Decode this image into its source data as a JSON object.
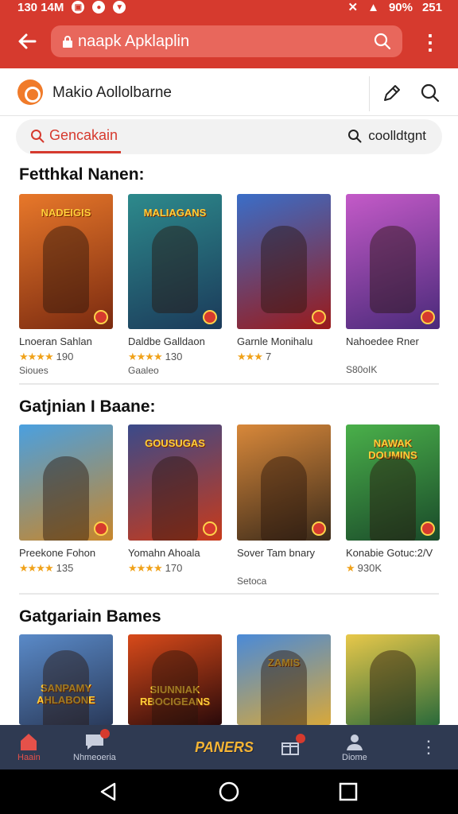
{
  "status_bar": {
    "time": "130 14M",
    "battery": "90%",
    "signal": "251"
  },
  "browser": {
    "url": "naapk Apklaplin"
  },
  "site": {
    "title": "Makio Aollolbarne"
  },
  "tabs": {
    "active_label": "Gencakain",
    "right_label": "coolldtgnt"
  },
  "sections": [
    {
      "title": "Fetthkal Nanen:",
      "items": [
        {
          "name": "Lnoeran Sahlan",
          "stars": "★★★★",
          "rating": "190",
          "sub": "Sioues",
          "logo": "NADEIGIS",
          "colors": [
            "#e8782a",
            "#7a2a10"
          ]
        },
        {
          "name": "Daldbe Galldaon",
          "stars": "★★★★",
          "rating": "130",
          "sub": "Gaaleo",
          "logo": "MALIAGANS",
          "colors": [
            "#2d8a8c",
            "#1b3a5a"
          ]
        },
        {
          "name": "Garnle Monihalu",
          "stars": "★★★",
          "rating": "7",
          "sub": "",
          "logo": "",
          "colors": [
            "#3a6ec8",
            "#9a1a1a"
          ]
        },
        {
          "name": "Nahoedee Rner",
          "stars": "",
          "rating": "",
          "sub": "S80oIK",
          "logo": "",
          "colors": [
            "#c45ac8",
            "#4a2a7a"
          ]
        }
      ]
    },
    {
      "title": "Gatjnian I Baane:",
      "items": [
        {
          "name": "Preekone Fohon",
          "stars": "★★★★",
          "rating": "135",
          "sub": "",
          "logo": "",
          "colors": [
            "#4aa0e0",
            "#c8862a"
          ]
        },
        {
          "name": "Yomahn Ahoala",
          "stars": "★★★★",
          "rating": "170",
          "sub": "",
          "logo": "GOUSUGAS",
          "colors": [
            "#3a4a8a",
            "#c83a1a"
          ]
        },
        {
          "name": "Sover Tam bnary",
          "stars": "",
          "rating": "",
          "sub": "Setoca",
          "logo": "",
          "colors": [
            "#d8883a",
            "#3a2a1a"
          ]
        },
        {
          "name": "Konabie Gotuc:2/V",
          "stars": "★",
          "rating": "930K",
          "sub": "",
          "logo": "NAWAK DOUMINS",
          "colors": [
            "#4ab04a",
            "#1a4a2a"
          ]
        }
      ]
    },
    {
      "title": "Gatgariain Bames",
      "items": [
        {
          "name": "",
          "stars": "",
          "rating": "",
          "sub": "",
          "logo": "SANPAMY AHLABONE",
          "colors": [
            "#5a8ac8",
            "#2a3a5a"
          ]
        },
        {
          "name": "",
          "stars": "",
          "rating": "",
          "sub": "",
          "logo": "SIUNNIAK RBOCIGEANS",
          "colors": [
            "#d84a1a",
            "#2a0a0a"
          ]
        },
        {
          "name": "",
          "stars": "",
          "rating": "",
          "sub": "",
          "logo": "ZAMIS",
          "colors": [
            "#4a8ad8",
            "#d8a83a"
          ]
        },
        {
          "name": "",
          "stars": "",
          "rating": "",
          "sub": "",
          "logo": "",
          "colors": [
            "#e8c84a",
            "#2a6a3a"
          ]
        }
      ]
    }
  ],
  "bottom_nav": {
    "home_label": "Haain",
    "messages_label": "Nhmeoeria",
    "promo_label": "PANERS",
    "profile_label": "Diome"
  },
  "icons": [
    "back-arrow-icon",
    "lock-icon",
    "search-icon",
    "more-vert-icon",
    "edit-icon",
    "home-icon",
    "chat-icon",
    "gift-icon",
    "user-icon",
    "system-back-icon",
    "system-home-icon",
    "system-recents-icon"
  ],
  "colors": {
    "brand": "#d63a2e",
    "nav_bg": "#2f3a52",
    "star": "#f0a21a"
  }
}
